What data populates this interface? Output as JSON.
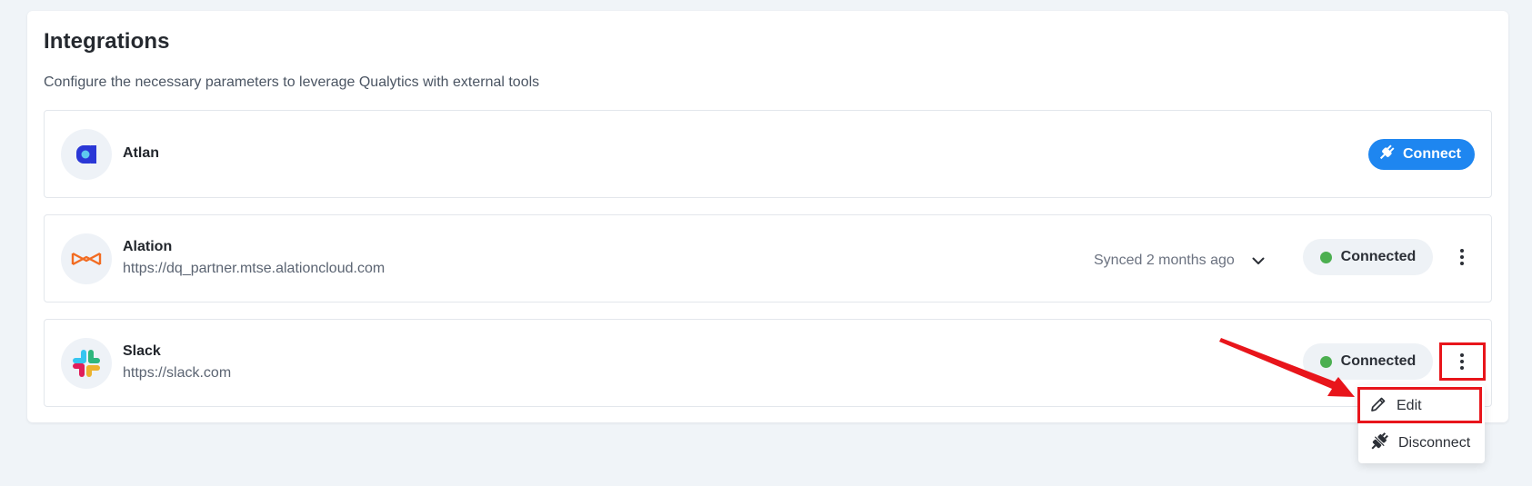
{
  "page": {
    "title": "Integrations",
    "subtitle": "Configure the necessary parameters to leverage Qualytics with external tools"
  },
  "integrations": [
    {
      "name": "Atlan",
      "action_label": "Connect",
      "icon": "atlan-logo"
    },
    {
      "name": "Alation",
      "url": "https://dq_partner.mtse.alationcloud.com",
      "sync_text": "Synced 2 months ago",
      "status": "Connected",
      "icon": "alation-logo"
    },
    {
      "name": "Slack",
      "url": "https://slack.com",
      "status": "Connected",
      "icon": "slack-logo"
    }
  ],
  "menu": {
    "items": [
      {
        "label": "Edit",
        "icon": "pencil-icon"
      },
      {
        "label": "Disconnect",
        "icon": "unplug-icon"
      }
    ]
  },
  "colors": {
    "primary": "#1e86f0",
    "connected_dot": "#4caf50",
    "annotation": "#e8151b"
  }
}
